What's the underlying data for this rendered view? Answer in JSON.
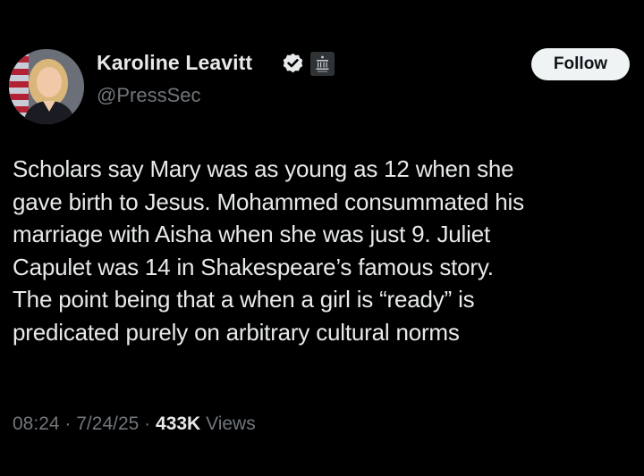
{
  "author": {
    "display_name": "Karoline Leavitt",
    "handle": "@PressSec",
    "verified_icon": "verified-badge-icon",
    "affiliation_icon": "white-house-badge-icon",
    "verified_color": "#e7e9ea"
  },
  "actions": {
    "follow_label": "Follow"
  },
  "tweet": {
    "text": "Scholars say Mary was as young as 12 when she\ngave birth to Jesus. Mohammed consummated his\nmarriage with Aisha when she was just 9. Juliet\nCapulet was 14 in Shakespeare’s famous story.\nThe point being that a when a girl is “ready” is\npredicated purely on arbitrary cultural norms"
  },
  "meta": {
    "time": "08:24",
    "date": "7/24/25",
    "views_count": "433K",
    "views_label": "Views",
    "separator": "·"
  },
  "colors": {
    "background": "#000000",
    "primary_text": "#e7e9ea",
    "secondary_text": "#71767b",
    "button_background": "#eff3f4"
  }
}
